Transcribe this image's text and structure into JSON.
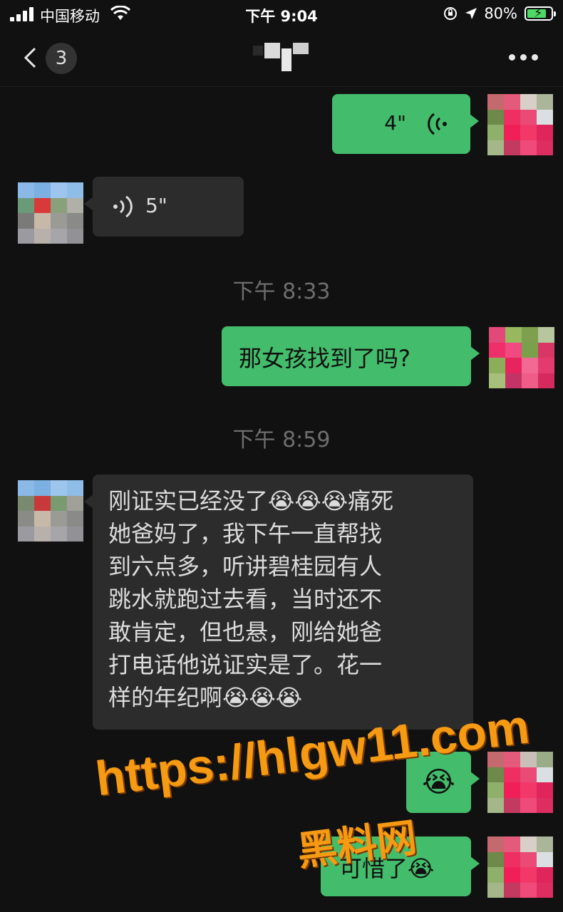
{
  "status_bar": {
    "carrier": "中国移动",
    "time": "下午 9:04",
    "battery": "80%",
    "battery_level": 0.8
  },
  "nav": {
    "unread_count": "3",
    "more_icon": "more-dots-icon",
    "back_icon": "chevron-left-icon"
  },
  "messages": [
    {
      "side": "out",
      "type": "voice",
      "duration": "4\""
    },
    {
      "side": "in",
      "type": "voice",
      "duration": "5\""
    },
    {
      "type": "time",
      "text": "下午 8:33"
    },
    {
      "side": "out",
      "type": "text",
      "text": "那女孩找到了吗?"
    },
    {
      "type": "time",
      "text": "下午 8:59"
    },
    {
      "side": "in",
      "type": "text",
      "lines": [
        "刚证实已经没了😭😭😭痛死",
        "她爸妈了，我下午一直帮找",
        "到六点多，听讲碧桂园有人",
        "跳水就跑过去看，当时还不",
        "敢肯定，但也悬，刚给她爸",
        "打电话他说证实是了。花一",
        "样的年纪啊😭😭😭"
      ]
    },
    {
      "side": "out",
      "type": "text",
      "text": "😭"
    },
    {
      "side": "out",
      "type": "text",
      "text": "可惜了😭"
    }
  ],
  "watermark": {
    "url": "https://hlgw11.com",
    "site_name": "黑料网"
  },
  "colors": {
    "background": "#111111",
    "outgoing_bubble": "#43bd6b",
    "incoming_bubble": "#2c2c2c",
    "watermark": "#f59a12"
  }
}
